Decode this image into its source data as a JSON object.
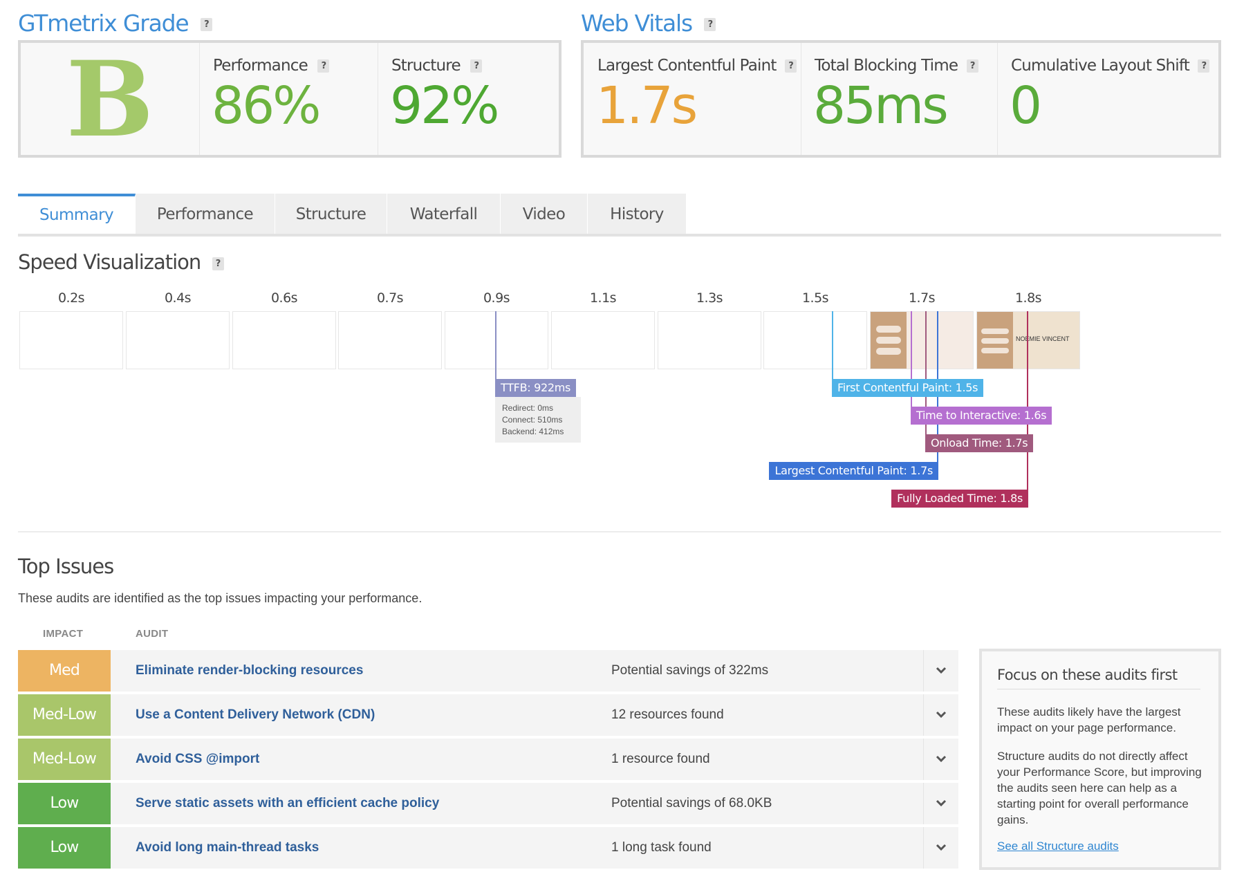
{
  "grade": {
    "title": "GTmetrix Grade",
    "help": "?",
    "letter": "B",
    "performance": {
      "label": "Performance",
      "value": "86%"
    },
    "structure": {
      "label": "Structure",
      "value": "92%"
    }
  },
  "vitals": {
    "title": "Web Vitals",
    "help": "?",
    "items": [
      {
        "label": "Largest Contentful Paint",
        "value": "1.7s",
        "color": "#e8a33a"
      },
      {
        "label": "Total Blocking Time",
        "value": "85ms",
        "color": "#5aab3b"
      },
      {
        "label": "Cumulative Layout Shift",
        "value": "0",
        "color": "#5aab3b"
      }
    ]
  },
  "tabs": [
    "Summary",
    "Performance",
    "Structure",
    "Waterfall",
    "Video",
    "History"
  ],
  "speed": {
    "title": "Speed Visualization",
    "help": "?",
    "ticks": [
      "0.2s",
      "0.4s",
      "0.6s",
      "0.7s",
      "0.9s",
      "1.1s",
      "1.3s",
      "1.5s",
      "1.7s",
      "1.8s"
    ],
    "frame_text": "NOEMIE VINCENT",
    "ttfb": {
      "label": "TTFB: 922ms",
      "redirect": "Redirect: 0ms",
      "connect": "Connect: 510ms",
      "backend": "Backend: 412ms",
      "color": "#8a8fc4"
    },
    "markers": [
      {
        "label": "First Contentful Paint: 1.5s",
        "color": "#4fb3e8"
      },
      {
        "label": "Time to Interactive: 1.6s",
        "color": "#b56fd0"
      },
      {
        "label": "Onload Time: 1.7s",
        "color": "#a05a7e"
      },
      {
        "label": "Largest Contentful Paint: 1.7s",
        "color": "#3c74d6"
      },
      {
        "label": "Fully Loaded Time: 1.8s",
        "color": "#b0305c"
      }
    ]
  },
  "issues": {
    "title": "Top Issues",
    "description": "These audits are identified as the top issues impacting your performance.",
    "col_impact": "IMPACT",
    "col_audit": "AUDIT",
    "rows": [
      {
        "impact": "Med",
        "color": "#edb462",
        "audit": "Eliminate render-blocking resources",
        "detail": "Potential savings of 322ms"
      },
      {
        "impact": "Med-Low",
        "color": "#a9c66a",
        "audit": "Use a Content Delivery Network (CDN)",
        "detail": "12 resources found"
      },
      {
        "impact": "Med-Low",
        "color": "#a9c66a",
        "audit": "Avoid CSS @import",
        "detail": "1 resource found"
      },
      {
        "impact": "Low",
        "color": "#5fae4e",
        "audit": "Serve static assets with an efficient cache policy",
        "detail": "Potential savings of 68.0KB"
      },
      {
        "impact": "Low",
        "color": "#5fae4e",
        "audit": "Avoid long main-thread tasks",
        "detail": "1 long task found"
      }
    ]
  },
  "focus": {
    "title": "Focus on these audits first",
    "para1": "These audits likely have the largest impact on your page performance.",
    "para2": "Structure audits do not directly affect your Performance Score, but improving the audits seen here can help as a starting point for overall performance gains.",
    "link": "See all Structure audits"
  }
}
